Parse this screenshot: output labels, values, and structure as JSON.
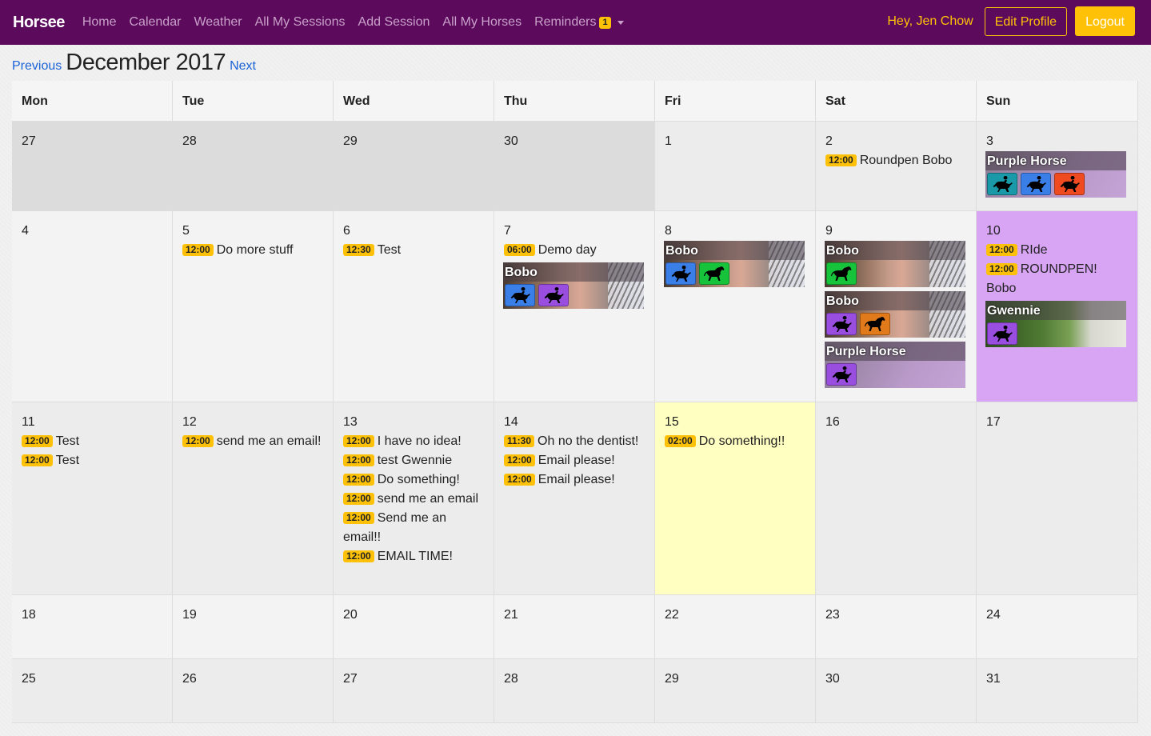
{
  "nav": {
    "brand": "Horsee",
    "items": [
      "Home",
      "Calendar",
      "Weather",
      "All My Sessions",
      "Add Session",
      "All My Horses"
    ],
    "reminders_label": "Reminders",
    "reminders_count": "1",
    "greeting": "Hey, Jen Chow",
    "edit_profile": "Edit Profile",
    "logout": "Logout"
  },
  "header": {
    "previous": "Previous",
    "title": "December 2017",
    "next": "Next"
  },
  "weekdays": [
    "Mon",
    "Tue",
    "Wed",
    "Thu",
    "Fri",
    "Sat",
    "Sun"
  ],
  "weeks": [
    [
      {
        "day": "27",
        "events": []
      },
      {
        "day": "28",
        "events": []
      },
      {
        "day": "29",
        "events": []
      },
      {
        "day": "30",
        "events": []
      },
      {
        "day": "1",
        "events": []
      },
      {
        "day": "2",
        "events": [
          {
            "time": "12:00",
            "title": "Roundpen Bobo"
          }
        ]
      },
      {
        "day": "3",
        "events": [],
        "cards": [
          {
            "horse": "Purple Horse",
            "icons": [
              {
                "color": "#1a9aa8",
                "type": "rider"
              },
              {
                "color": "#3a7ee8",
                "type": "rider"
              },
              {
                "color": "#ef4a20",
                "type": "rider"
              }
            ]
          }
        ]
      }
    ],
    [
      {
        "day": "4",
        "events": []
      },
      {
        "day": "5",
        "events": [
          {
            "time": "12:00",
            "title": "Do more stuff"
          }
        ]
      },
      {
        "day": "6",
        "events": [
          {
            "time": "12:30",
            "title": "Test"
          }
        ]
      },
      {
        "day": "7",
        "events": [
          {
            "time": "06:00",
            "title": "Demo day"
          }
        ],
        "cards": [
          {
            "horse": "Bobo",
            "icons": [
              {
                "color": "#3a7ee8",
                "type": "rider"
              },
              {
                "color": "#9a4ee0",
                "type": "rider"
              }
            ]
          }
        ]
      },
      {
        "day": "8",
        "events": [],
        "cards": [
          {
            "horse": "Bobo",
            "icons": [
              {
                "color": "#3a7ee8",
                "type": "rider"
              },
              {
                "color": "#16c33a",
                "type": "horse"
              }
            ]
          }
        ]
      },
      {
        "day": "9",
        "events": [],
        "cards": [
          {
            "horse": "Bobo",
            "icons": [
              {
                "color": "#16c33a",
                "type": "horse"
              }
            ]
          },
          {
            "horse": "Bobo",
            "icons": [
              {
                "color": "#9a4ee0",
                "type": "rider"
              },
              {
                "color": "#e07a1a",
                "type": "horse"
              }
            ]
          },
          {
            "horse": "Purple Horse",
            "icons": [
              {
                "color": "#9a4ee0",
                "type": "rider"
              }
            ]
          }
        ]
      },
      {
        "day": "10",
        "events": [
          {
            "time": "12:00",
            "title": "RIde"
          },
          {
            "time": "12:00",
            "title": "ROUNDPEN! Bobo"
          }
        ],
        "cards": [
          {
            "horse": "Gwennie",
            "icons": [
              {
                "color": "#9a4ee0",
                "type": "rider"
              }
            ]
          }
        ]
      }
    ],
    [
      {
        "day": "11",
        "events": [
          {
            "time": "12:00",
            "title": "Test"
          },
          {
            "time": "12:00",
            "title": "Test"
          }
        ]
      },
      {
        "day": "12",
        "events": [
          {
            "time": "12:00",
            "title": "send me an email!"
          }
        ]
      },
      {
        "day": "13",
        "events": [
          {
            "time": "12:00",
            "title": "I have no idea!"
          },
          {
            "time": "12:00",
            "title": "test Gwennie"
          },
          {
            "time": "12:00",
            "title": "Do something!"
          },
          {
            "time": "12:00",
            "title": "send me an email"
          },
          {
            "time": "12:00",
            "title": "Send me an email!!"
          },
          {
            "time": "12:00",
            "title": "EMAIL TIME!"
          }
        ]
      },
      {
        "day": "14",
        "events": [
          {
            "time": "11:30",
            "title": "Oh no the dentist!"
          },
          {
            "time": "12:00",
            "title": "Email please!"
          },
          {
            "time": "12:00",
            "title": "Email please!"
          }
        ]
      },
      {
        "day": "15",
        "events": [
          {
            "time": "02:00",
            "title": "Do something!!"
          }
        ]
      },
      {
        "day": "16",
        "events": []
      },
      {
        "day": "17",
        "events": []
      }
    ],
    [
      {
        "day": "18",
        "events": []
      },
      {
        "day": "19",
        "events": []
      },
      {
        "day": "20",
        "events": []
      },
      {
        "day": "21",
        "events": []
      },
      {
        "day": "22",
        "events": []
      },
      {
        "day": "23",
        "events": []
      },
      {
        "day": "24",
        "events": []
      }
    ],
    [
      {
        "day": "25",
        "events": []
      },
      {
        "day": "26",
        "events": []
      },
      {
        "day": "27",
        "events": []
      },
      {
        "day": "28",
        "events": []
      },
      {
        "day": "29",
        "events": []
      },
      {
        "day": "30",
        "events": []
      },
      {
        "day": "31",
        "events": []
      }
    ]
  ]
}
